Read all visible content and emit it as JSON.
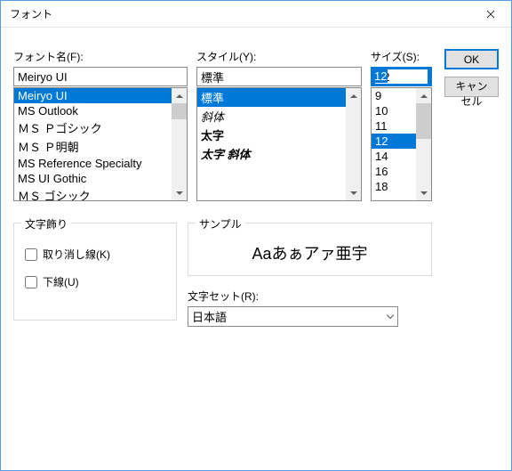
{
  "window": {
    "title": "フォント"
  },
  "labels": {
    "font": "フォント名(F):",
    "style": "スタイル(Y):",
    "size": "サイズ(S):",
    "decor": "文字飾り",
    "strike": "取り消し線(K)",
    "underline": "下線(U)",
    "sample": "サンプル",
    "charset": "文字セット(R):"
  },
  "inputs": {
    "font": "Meiryo UI",
    "style": "標準",
    "size": "12"
  },
  "fontList": [
    {
      "label": "Meiryo UI",
      "selected": true
    },
    {
      "label": "MS Outlook"
    },
    {
      "label": "ＭＳ Ｐゴシック"
    },
    {
      "label": "ＭＳ Ｐ明朝"
    },
    {
      "label": "MS Reference Specialty"
    },
    {
      "label": "MS UI Gothic"
    },
    {
      "label": "ＭＳ  ゴシック"
    }
  ],
  "styleList": [
    {
      "label": "標準",
      "selected": true
    },
    {
      "label": "斜体",
      "style": "italic"
    },
    {
      "label": "太字",
      "style": "bold"
    },
    {
      "label": "太字 斜体",
      "style": "bolditalic"
    }
  ],
  "sizeList": [
    {
      "label": "9"
    },
    {
      "label": "10"
    },
    {
      "label": "11"
    },
    {
      "label": "12",
      "selected": true
    },
    {
      "label": "14"
    },
    {
      "label": "16"
    },
    {
      "label": "18"
    }
  ],
  "buttons": {
    "ok": "OK",
    "cancel": "キャンセル"
  },
  "sample_text": "Aaあぁアァ亜宇",
  "charset_value": "日本語"
}
